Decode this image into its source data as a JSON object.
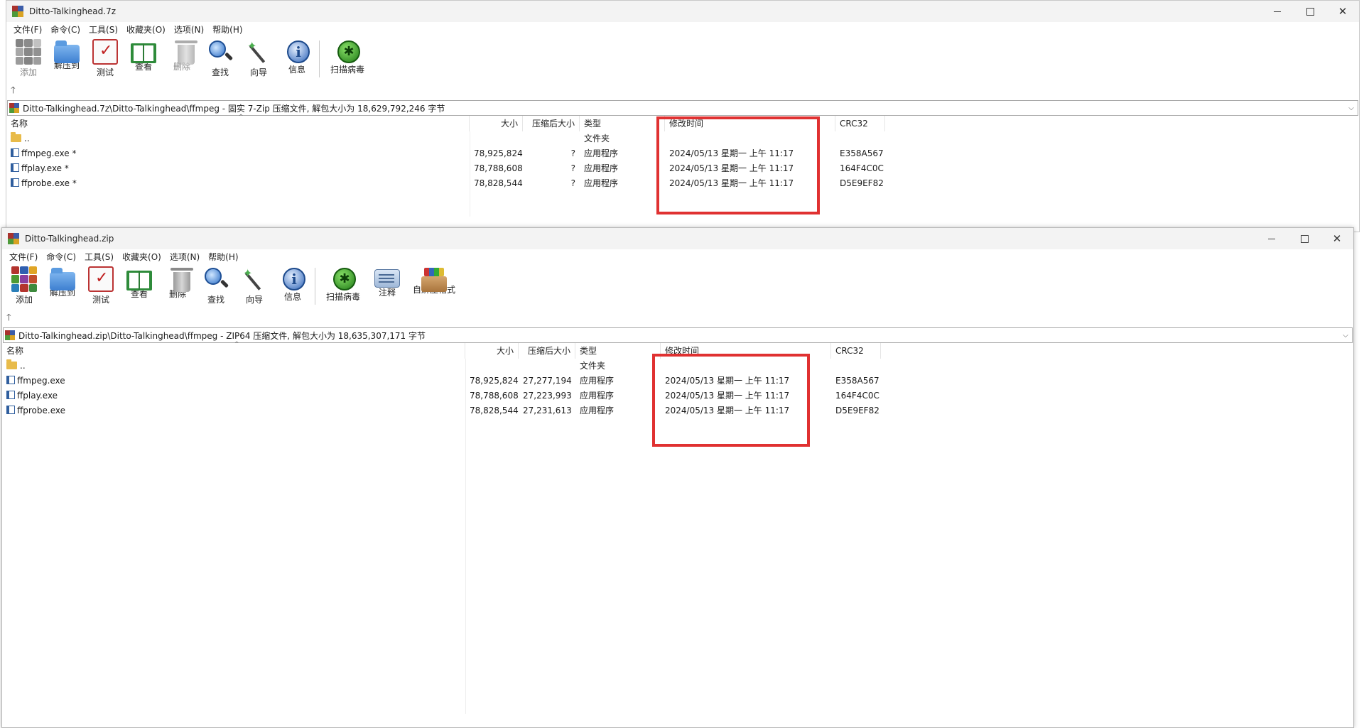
{
  "menu": [
    "文件(F)",
    "命令(C)",
    "工具(S)",
    "收藏夹(O)",
    "选项(N)",
    "帮助(H)"
  ],
  "columns": {
    "name": "名称",
    "size": "大小",
    "packed": "压缩后大小",
    "type": "类型",
    "mtime": "修改时间",
    "crc": "CRC32"
  },
  "window1": {
    "title": "Ditto-Talkinghead.7z",
    "toolbar": [
      {
        "label": "添加",
        "icon": "add-archive-icon",
        "enabled": false
      },
      {
        "label": "解压到",
        "icon": "extract-folder-icon",
        "enabled": true
      },
      {
        "label": "测试",
        "icon": "test-clipboard-icon",
        "enabled": true
      },
      {
        "label": "查看",
        "icon": "view-book-icon",
        "enabled": true
      },
      {
        "label": "删除",
        "icon": "delete-trash-icon",
        "enabled": false
      },
      {
        "label": "查找",
        "icon": "find-magnifier-icon",
        "enabled": true
      },
      {
        "label": "向导",
        "icon": "wizard-wand-icon",
        "enabled": true
      },
      {
        "label": "信息",
        "icon": "info-icon",
        "enabled": true
      },
      {
        "label": "扫描病毒",
        "icon": "scan-virus-icon",
        "enabled": true
      }
    ],
    "address": "Ditto-Talkinghead.7z\\Ditto-Talkinghead\\ffmpeg - 固实 7-Zip 压缩文件, 解包大小为 18,629,792,246 字节",
    "parent_row": {
      "name": "..",
      "type": "文件夹"
    },
    "files": [
      {
        "name": "ffmpeg.exe *",
        "size": "78,925,824",
        "packed": "?",
        "type": "应用程序",
        "mtime": "2024/05/13 星期一 上午 11:17",
        "crc": "E358A567"
      },
      {
        "name": "ffplay.exe *",
        "size": "78,788,608",
        "packed": "?",
        "type": "应用程序",
        "mtime": "2024/05/13 星期一 上午 11:17",
        "crc": "164F4C0C"
      },
      {
        "name": "ffprobe.exe *",
        "size": "78,828,544",
        "packed": "?",
        "type": "应用程序",
        "mtime": "2024/05/13 星期一 上午 11:17",
        "crc": "D5E9EF82"
      }
    ]
  },
  "window2": {
    "title": "Ditto-Talkinghead.zip",
    "toolbar": [
      {
        "label": "添加",
        "icon": "add-archive-icon",
        "enabled": true
      },
      {
        "label": "解压到",
        "icon": "extract-folder-icon",
        "enabled": true
      },
      {
        "label": "测试",
        "icon": "test-clipboard-icon",
        "enabled": true
      },
      {
        "label": "查看",
        "icon": "view-book-icon",
        "enabled": true
      },
      {
        "label": "删除",
        "icon": "delete-trash-icon",
        "enabled": true
      },
      {
        "label": "查找",
        "icon": "find-magnifier-icon",
        "enabled": true
      },
      {
        "label": "向导",
        "icon": "wizard-wand-icon",
        "enabled": true
      },
      {
        "label": "信息",
        "icon": "info-icon",
        "enabled": true
      },
      {
        "label": "扫描病毒",
        "icon": "scan-virus-icon",
        "enabled": true
      },
      {
        "label": "注释",
        "icon": "comment-icon",
        "enabled": true
      },
      {
        "label": "自解压格式",
        "icon": "sfx-box-icon",
        "enabled": true
      }
    ],
    "address": "Ditto-Talkinghead.zip\\Ditto-Talkinghead\\ffmpeg - ZIP64 压缩文件, 解包大小为 18,635,307,171 字节",
    "parent_row": {
      "name": "..",
      "type": "文件夹"
    },
    "files": [
      {
        "name": "ffmpeg.exe",
        "size": "78,925,824",
        "packed": "27,277,194",
        "type": "应用程序",
        "mtime": "2024/05/13 星期一 上午 11:17",
        "crc": "E358A567"
      },
      {
        "name": "ffplay.exe",
        "size": "78,788,608",
        "packed": "27,223,993",
        "type": "应用程序",
        "mtime": "2024/05/13 星期一 上午 11:17",
        "crc": "164F4C0C"
      },
      {
        "name": "ffprobe.exe",
        "size": "78,828,544",
        "packed": "27,231,613",
        "type": "应用程序",
        "mtime": "2024/05/13 星期一 上午 11:17",
        "crc": "D5E9EF82"
      }
    ]
  },
  "highlight_color": "#e03131"
}
